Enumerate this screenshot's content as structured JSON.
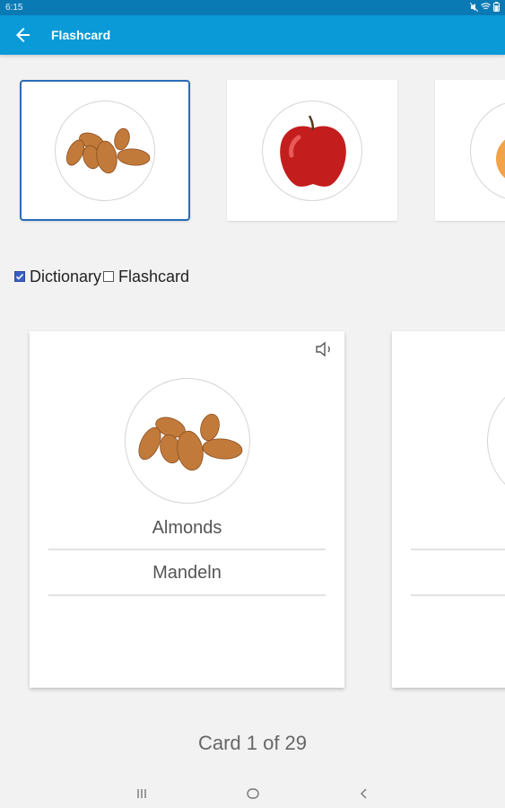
{
  "status_bar": {
    "time": "6:15",
    "icons": [
      "mute-icon",
      "wifi-icon",
      "battery-icon"
    ]
  },
  "app_bar": {
    "back_icon": "arrow-left-icon",
    "title": "Flashcard"
  },
  "thumbnails": [
    {
      "name": "almonds",
      "selected": true
    },
    {
      "name": "apple",
      "selected": false
    },
    {
      "name": "apricot",
      "selected": false
    }
  ],
  "toggles": {
    "dictionary": {
      "label": "Dictionary",
      "checked": true
    },
    "flashcard": {
      "label": "Flashcard",
      "checked": false
    }
  },
  "current_card": {
    "speaker_icon": "speaker-icon",
    "english": "Almonds",
    "german": "Mandeln"
  },
  "counter": "Card 1 of 29",
  "colors": {
    "app_bar": "#0a9ad8",
    "status_bar": "#0a7ab5",
    "selected_border": "#2a6bb8",
    "checkbox": "#3a5fc4"
  },
  "nav_bar": {
    "recent_icon": "recent-apps-icon",
    "home_icon": "home-icon",
    "back_icon": "nav-back-icon"
  }
}
